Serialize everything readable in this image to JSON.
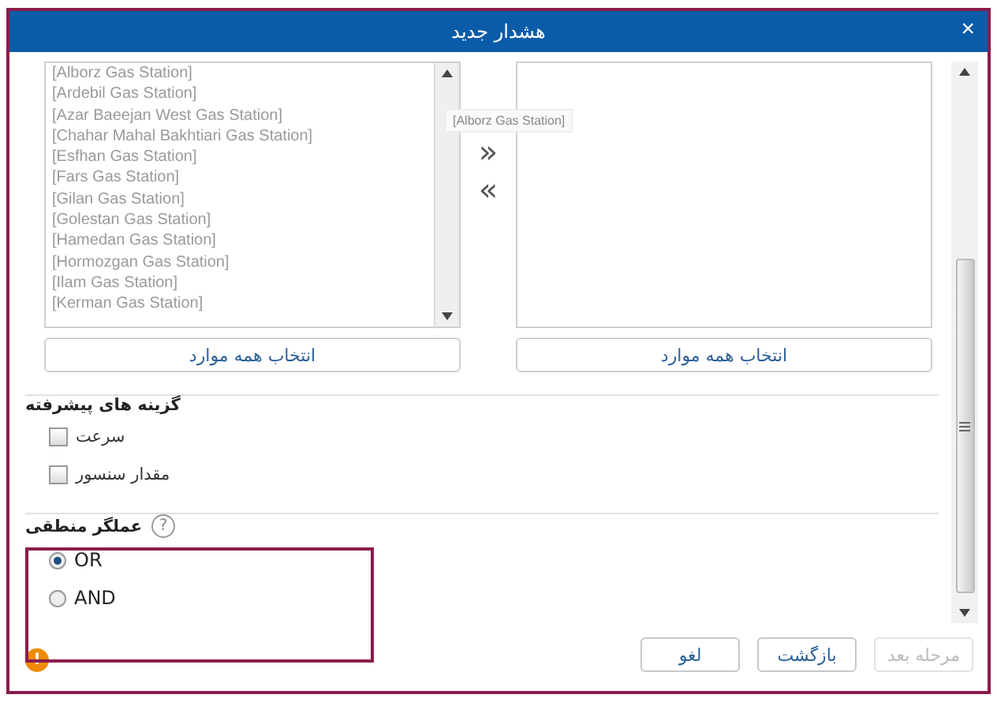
{
  "window": {
    "title": "هشدار جدید",
    "close": "×"
  },
  "source_list": {
    "items": [
      "[Alborz Gas Station]",
      "[Ardebil Gas Station]",
      "[Azar Baeejan West Gas Station]",
      "[Chahar Mahal Bakhtiari Gas Station]",
      "[Esfhan Gas Station]",
      "[Fars Gas Station]",
      "[Gilan Gas Station]",
      "[Golestan Gas Station]",
      "[Hamedan Gas Station]",
      "[Hormozgan Gas Station]",
      "[Ilam Gas Station]",
      "[Kerman Gas Station]"
    ],
    "select_all": "انتخاب همه موارد"
  },
  "drag_tooltip": "[Alborz Gas Station]",
  "move_buttons": [
    "»",
    "«"
  ],
  "target_list": {
    "select_all": "انتخاب همه موارد"
  },
  "advanced": {
    "title": "گزینه های پیشرفته",
    "options": [
      {
        "label": "سرعت",
        "checked": false
      },
      {
        "label": "مقدار سنسور",
        "checked": false
      }
    ]
  },
  "logic": {
    "title": "عملگر منطقی",
    "help": "?",
    "options": [
      {
        "label": "OR",
        "selected": true
      },
      {
        "label": "AND",
        "selected": false
      }
    ]
  },
  "warning": "!",
  "footer": [
    {
      "label": "مرحله بعد",
      "disabled": true
    },
    {
      "label": "بازگشت",
      "disabled": false
    },
    {
      "label": "لغو",
      "disabled": false
    }
  ]
}
